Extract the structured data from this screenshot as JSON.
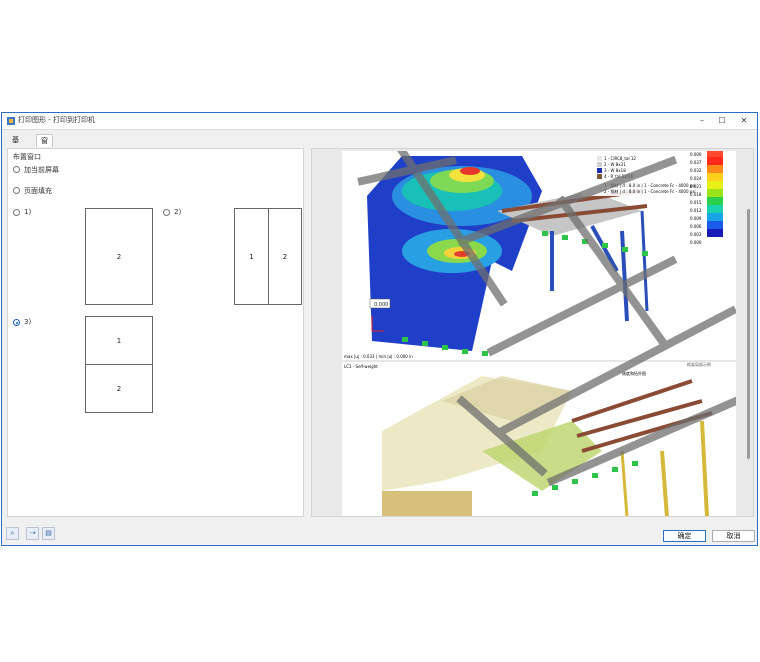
{
  "window": {
    "title": "打印图形 - 打印到打印机"
  },
  "tabs": [
    {
      "label": "基本"
    },
    {
      "label": "窗口布置"
    }
  ],
  "layout_section": {
    "title": "布置窗口",
    "options": {
      "current_screen": "加当前屏幕",
      "fill_page": "页面填充",
      "opt1": "1)",
      "opt2": "2)",
      "opt3": "3)"
    },
    "selected": "opt3",
    "page1_cells": [
      "2"
    ],
    "page2_cells": [
      "1",
      "2"
    ],
    "page3_cells": [
      "1",
      "2"
    ]
  },
  "preview": {
    "top_caption": "max |u| : 0.033 | min |u| : 0.000 in",
    "bottom_caption": "LC1 - Self-weight",
    "badge": "0.000",
    "legend_values": [
      "0.000",
      "0.037",
      "0.032",
      "0.024",
      "0.021",
      "0.018",
      "0.015",
      "0.012",
      "0.009",
      "0.006",
      "0.003",
      "0.000"
    ],
    "section_list": [
      "1 - CIRC8_tal 12",
      "2 - W 8x31",
      "3 - W 8x18",
      "4 - R_tal 12/16"
    ],
    "materials": [
      "1 - 钢材 | d : 8.0 in | 1 - Concrete Fc - 4000 psi",
      "2 - 钢材 | d : 8.0 in | 1 - Concrete Fc - 4000 psi"
    ],
    "right_header": "刚度和拓扑图",
    "right_note": "框架局部示例"
  },
  "footer": {
    "ok": "确定",
    "cancel": "取消"
  }
}
